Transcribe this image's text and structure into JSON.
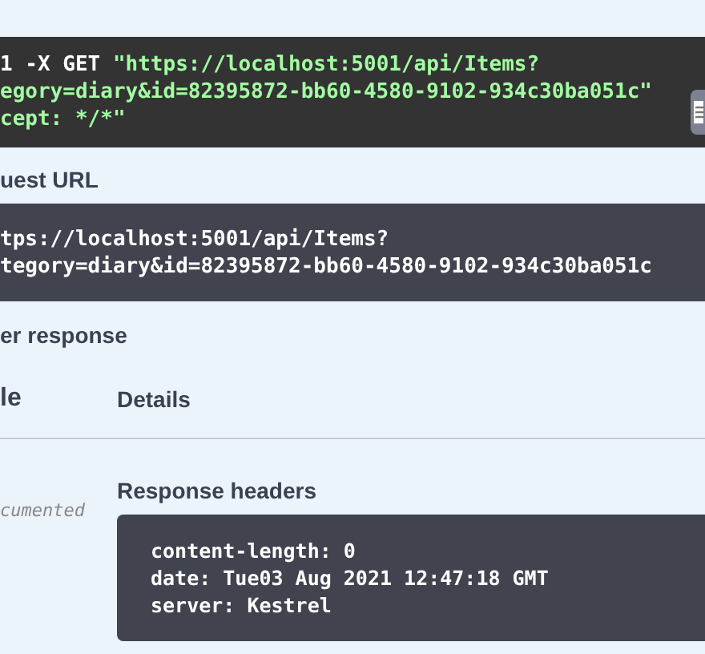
{
  "curl": {
    "command_prefix": "1 -X GET",
    "lines": [
      "\"https://localhost:5001/api/Items?",
      "egory=diary&id=82395872-bb60-4580-9102-934c30ba051c\"",
      "cept: */*\""
    ]
  },
  "request_url": {
    "label": "uest URL",
    "lines": [
      "tps://localhost:5001/api/Items?",
      "tegory=diary&id=82395872-bb60-4580-9102-934c30ba051c"
    ]
  },
  "server_response": {
    "label": "er response",
    "columns": [
      "le",
      "Details"
    ],
    "rows": [
      {
        "code": "cumented",
        "details_label": "Response headers",
        "headers": [
          "content-length: 0",
          "date: Tue03 Aug 2021 12:47:18 GMT",
          "server: Kestrel"
        ]
      }
    ]
  }
}
